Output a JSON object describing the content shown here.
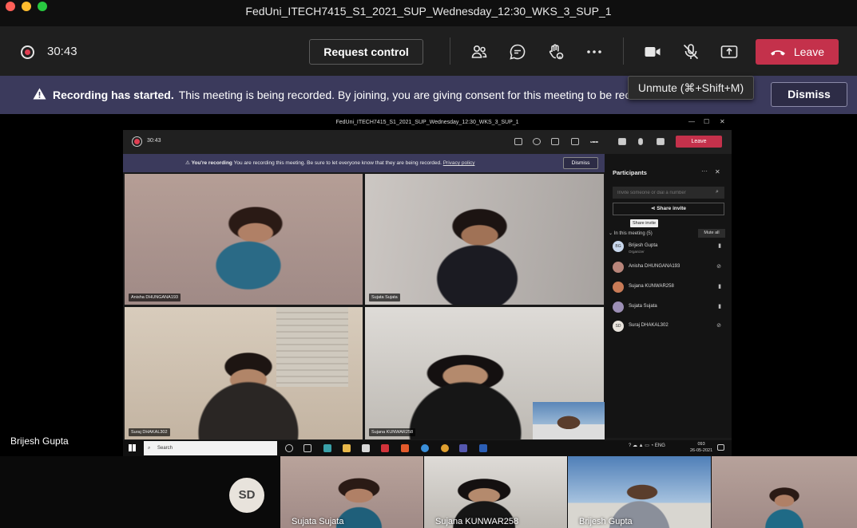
{
  "window": {
    "title": "FedUni_ITECH7415_S1_2021_SUP_Wednesday_12:30_WKS_3_SUP_1"
  },
  "toolbar": {
    "timer": "30:43",
    "request_control_label": "Request control",
    "leave_label": "Leave",
    "icons": [
      "people-icon",
      "chat-icon",
      "raise-hand-icon",
      "more-icon",
      "camera-icon",
      "mic-muted-icon",
      "share-tray-icon"
    ]
  },
  "banner": {
    "title": "Recording has started.",
    "text": "This meeting is being recorded. By joining, you are giving consent for this meeting to be rec",
    "dismiss_label": "Dismiss"
  },
  "tooltip": {
    "text": "Unmute (⌘+Shift+M)"
  },
  "shared_screen": {
    "title": "FedUni_ITECH7415_S1_2021_SUP_Wednesday_12:30_WKS_3_SUP_1",
    "timer": "30:43",
    "leave_label": "Leave",
    "banner_title": "You're recording",
    "banner_text": "You are recording this meeting. Be sure to let everyone know that they are being recorded.",
    "banner_link": "Privacy policy",
    "dismiss_label": "Dismiss",
    "tiles": [
      {
        "name": "Anisha DHUNGANA193"
      },
      {
        "name": "Sujata Sujata"
      },
      {
        "name": "Suraj DHAKAL302"
      },
      {
        "name": "Sujana KUNWAR258"
      }
    ],
    "participants": {
      "title": "Participants",
      "invite_placeholder": "Invite someone or dial a number",
      "share_invite_label": "Share invite",
      "share_invite_tooltip": "Share invite",
      "section_label": "In this meeting (5)",
      "mute_all_label": "Mute all",
      "people": [
        {
          "initials": "BG",
          "name": "Brijesh Gupta",
          "role": "Organizer"
        },
        {
          "initials": "",
          "name": "Anisha DHUNGANA193",
          "role": ""
        },
        {
          "initials": "",
          "name": "Sujana KUNWAR258",
          "role": ""
        },
        {
          "initials": "",
          "name": "Sujata Sujata",
          "role": ""
        },
        {
          "initials": "SD",
          "name": "Suraj DHAKAL302",
          "role": ""
        }
      ]
    },
    "taskbar": {
      "search_placeholder": "Search",
      "tray_lang": "ENG",
      "clock_time": "093",
      "clock_date": "26-05-2021"
    }
  },
  "presenter": {
    "name": "Brijesh Gupta"
  },
  "strip": {
    "avatar_initials": "SD",
    "tiles": [
      {
        "name": "Sujata Sujata"
      },
      {
        "name": "Sujana KUNWAR258"
      },
      {
        "name": "Brijesh Gupta"
      },
      {
        "name": ""
      }
    ]
  },
  "colors": {
    "leave": "#c4314b",
    "banner": "#3b3a5c",
    "toolbar": "#1f1f1f",
    "record": "#e03e52"
  }
}
